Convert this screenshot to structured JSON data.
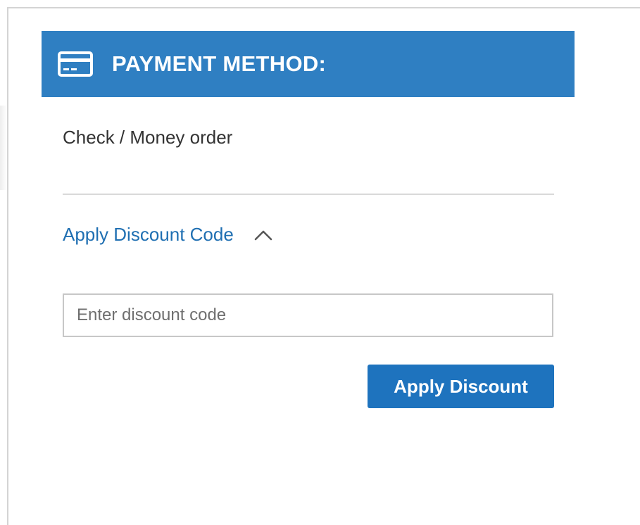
{
  "colors": {
    "header_background": "#2f7fc2",
    "link": "#1f6fb2",
    "button_background": "#1e73be"
  },
  "payment": {
    "header_icon": "credit-card-icon",
    "title": "PAYMENT METHOD:",
    "selected_method": "Check / Money order"
  },
  "discount": {
    "toggle_label": "Apply Discount Code",
    "toggle_icon": "chevron-up-icon",
    "input_placeholder": "Enter discount code",
    "input_value": "",
    "apply_button_label": "Apply Discount"
  }
}
